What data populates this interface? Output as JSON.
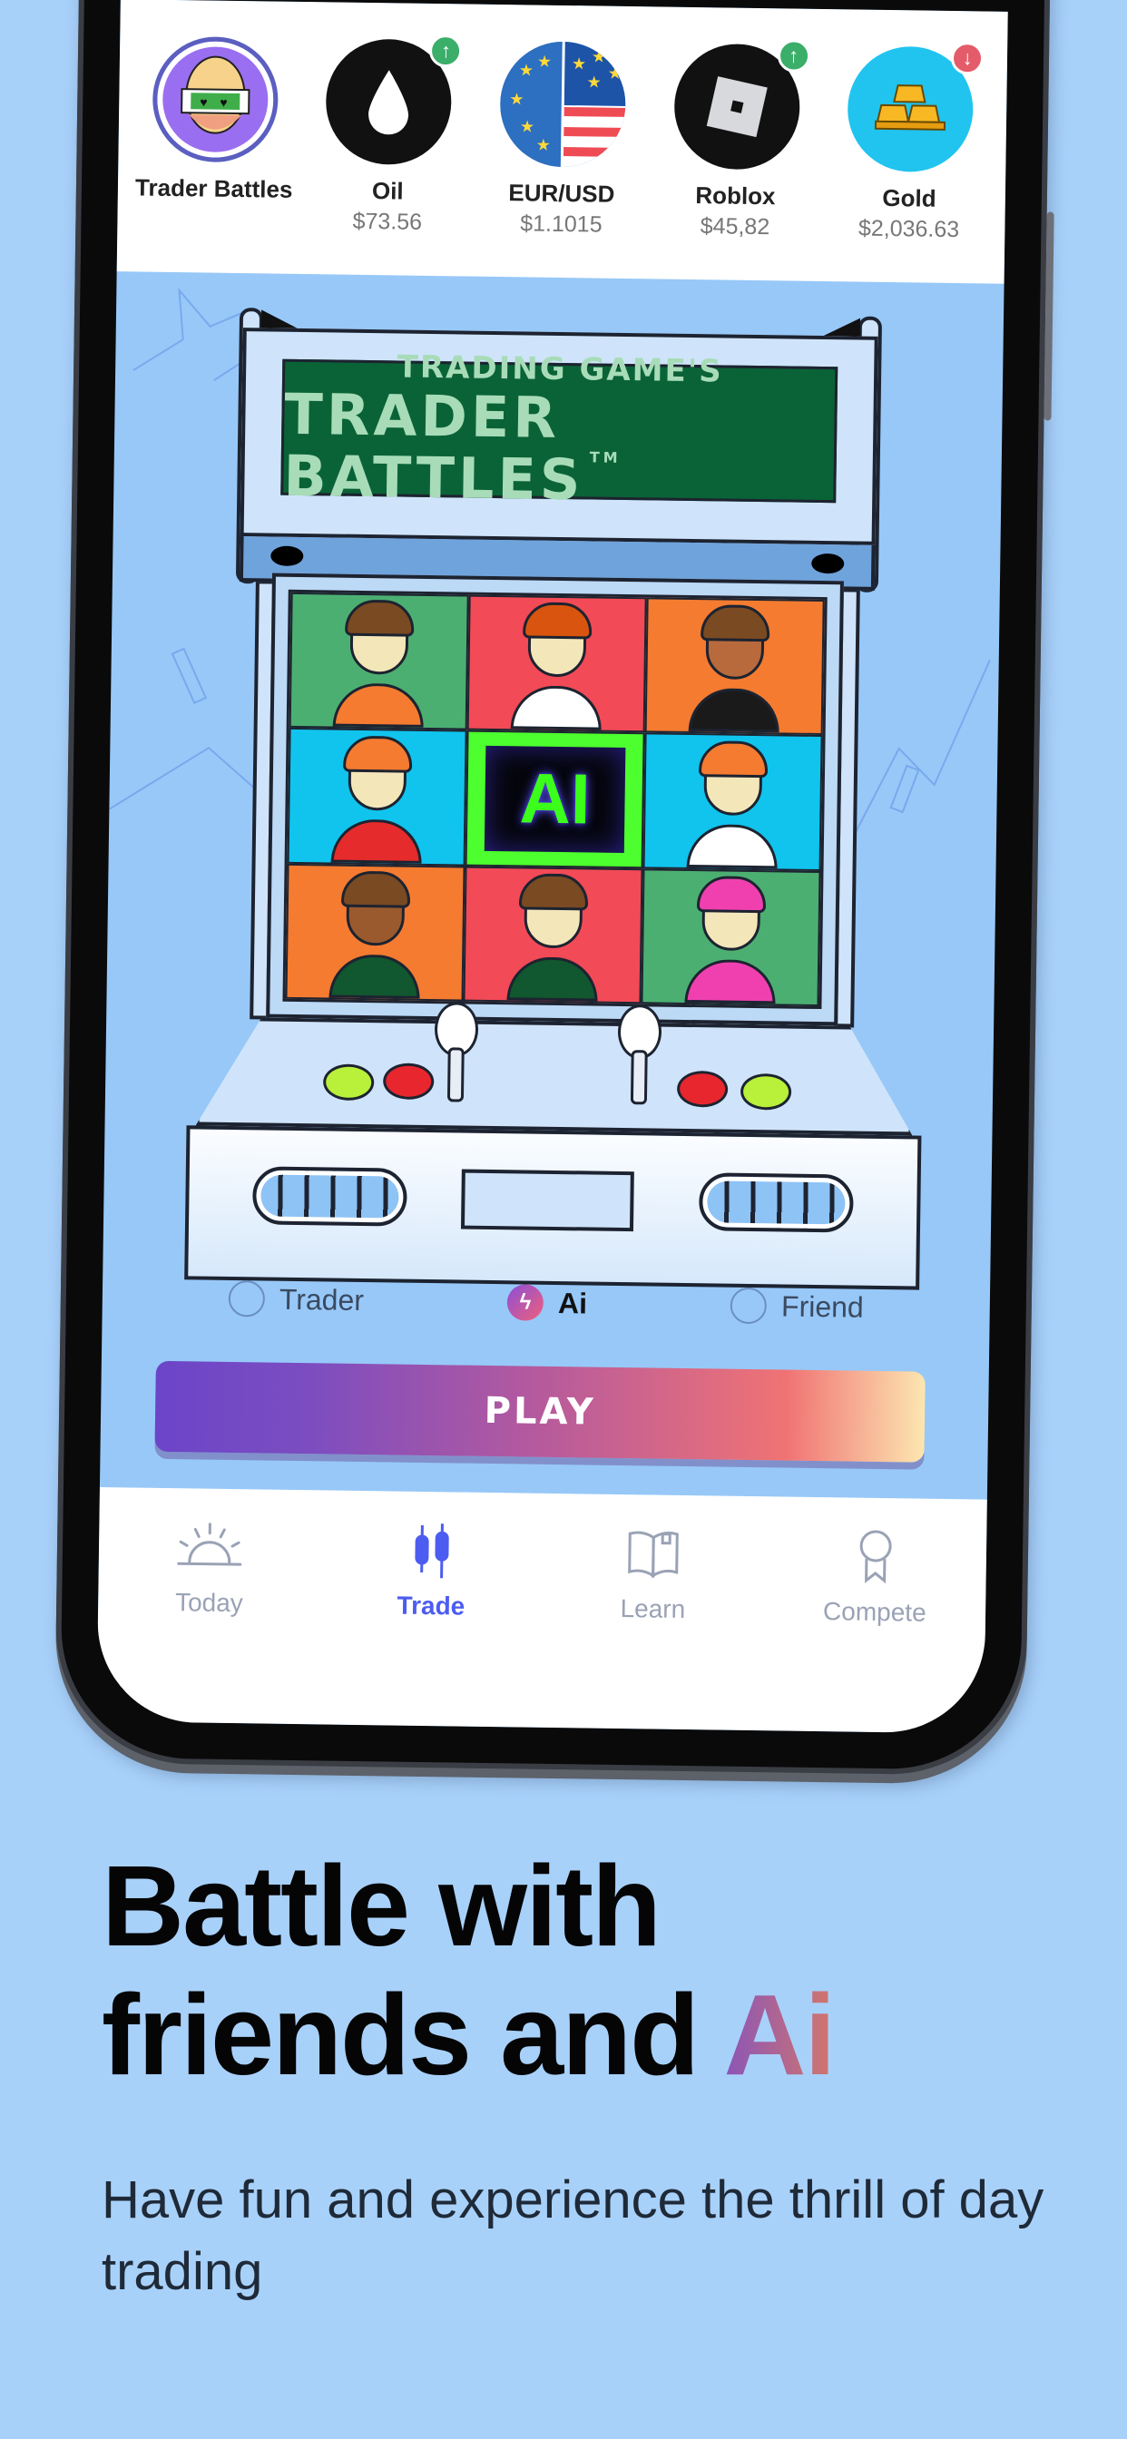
{
  "ticker": [
    {
      "name": "Trader Battles",
      "price": null,
      "icon": "trader-avatar-icon",
      "trend": null
    },
    {
      "name": "Oil",
      "price": "$73.56",
      "icon": "oil-drop-icon",
      "trend": "up"
    },
    {
      "name": "EUR/USD",
      "price": "$1.1015",
      "icon": "eur-usd-flag-icon",
      "trend": null
    },
    {
      "name": "Roblox",
      "price": "$45,82",
      "icon": "roblox-logo-icon",
      "trend": "up"
    },
    {
      "name": "Gold",
      "price": "$2,036.63",
      "icon": "gold-bars-icon",
      "trend": "down"
    }
  ],
  "trend_arrows": {
    "up": "↑",
    "down": "↓"
  },
  "arcade": {
    "marquee_subtitle": "TRADING GAME'S",
    "marquee_title": "TRADER BATTLES",
    "trademark": "TM",
    "ai_tile_label": "AI",
    "avatars": [
      {
        "bg": "#4caf72",
        "hair": "#7a4a22",
        "shirt": "#f47b30",
        "skin": "#f3e6b9"
      },
      {
        "bg": "#f24a57",
        "hair": "#d9540e",
        "shirt": "#ffffff",
        "skin": "#f3e6b9"
      },
      {
        "bg": "#f47b30",
        "hair": "#7a4a22",
        "shirt": "#1a1a1a",
        "skin": "#b86a3c"
      },
      {
        "bg": "#10c4ee",
        "hair": "#f47b30",
        "shirt": "#e52b2b",
        "skin": "#f3e6b9"
      },
      null,
      {
        "bg": "#10c4ee",
        "hair": "#f47b30",
        "shirt": "#ffffff",
        "skin": "#f3e6b9"
      },
      {
        "bg": "#f47b30",
        "hair": "#7a4a22",
        "shirt": "#11572f",
        "skin": "#9a5a2e"
      },
      {
        "bg": "#f24a57",
        "hair": "#7a4a22",
        "shirt": "#11572f",
        "skin": "#f3e6b9"
      },
      {
        "bg": "#4caf72",
        "hair": "#f040b0",
        "shirt": "#f040b0",
        "skin": "#f3e6b9"
      }
    ]
  },
  "modes": [
    {
      "label": "Trader",
      "selected": false
    },
    {
      "label": "Ai",
      "selected": true,
      "icon": "lightning-icon",
      "glyph": "ϟ"
    },
    {
      "label": "Friend",
      "selected": false
    }
  ],
  "play_label": "PLAY",
  "tabs": [
    {
      "label": "Today",
      "icon": "sunrise-icon",
      "active": false
    },
    {
      "label": "Trade",
      "icon": "candlestick-icon",
      "active": true
    },
    {
      "label": "Learn",
      "icon": "book-icon",
      "active": false
    },
    {
      "label": "Compete",
      "icon": "award-ribbon-icon",
      "active": false
    }
  ],
  "headline": {
    "line1": "Battle with",
    "line2": "friends and ",
    "highlight": "Ai"
  },
  "subhead": "Have fun and experience the thrill of day trading",
  "colors": {
    "background": "#a8d1fa",
    "accent_tab": "#4d5cf0",
    "play_gradient_start": "#6b45c8",
    "play_gradient_end": "#fce6b0",
    "up": "#3bae6a",
    "down": "#e45b6a"
  }
}
